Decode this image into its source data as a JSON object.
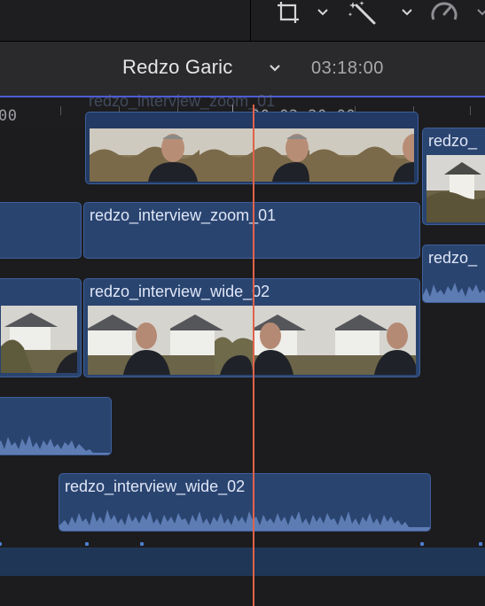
{
  "toolbar": {
    "tools": [
      {
        "icon": "crop-transform-icon"
      },
      {
        "icon": "magic-wand-icon"
      },
      {
        "icon": "speed-retime-icon"
      }
    ]
  },
  "project": {
    "title": "Redzo Garic",
    "duration": "03:18:00"
  },
  "ruler": {
    "labels": [
      "00",
      "00:02:20:00"
    ]
  },
  "clips": {
    "top_faded_label": "redzo_interview_zoom_01",
    "zoom_01": "redzo_interview_zoom_01",
    "wide_02_video": "redzo_interview_wide_02",
    "wide_02_audio": "redzo_interview_wide_02",
    "right_clip_1": "redzo_",
    "right_clip_2": "redzo_"
  },
  "colors": {
    "clip_fill": "#2a4470",
    "clip_border": "#3e5f9a",
    "playhead": "#e0624a",
    "header_accent": "#4e5bd6"
  }
}
